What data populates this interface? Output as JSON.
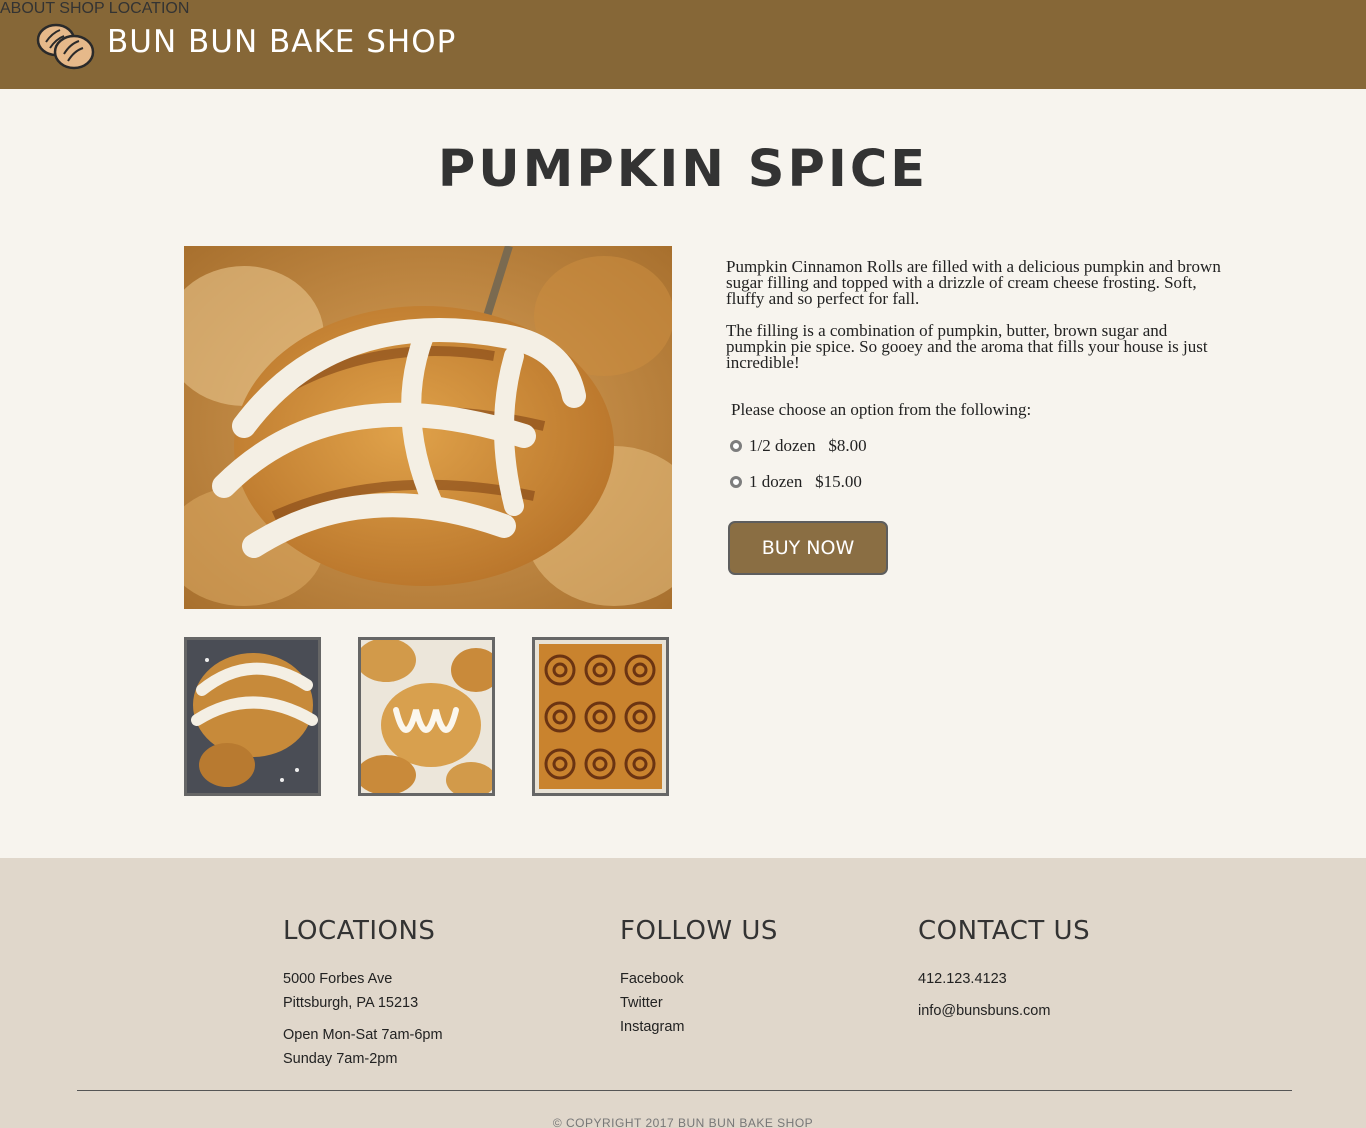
{
  "header": {
    "brand": "BUN BUN BAKE SHOP",
    "nav": {
      "about": "ABOUT",
      "shop": "SHOP",
      "location": "LOCATION"
    }
  },
  "product": {
    "title": "PUMPKIN SPICE",
    "description_1": "Pumpkin Cinnamon Rolls are filled with a delicious pumpkin and brown sugar filling and topped with a drizzle of cream cheese frosting. Soft, fluffy and so perfect for fall.",
    "description_2": "The filling is a combination of pumpkin, butter, brown sugar and pumpkin pie spice. So gooey and the aroma that fills your house is just incredible!",
    "prompt": "Please choose an option from the following:",
    "options": [
      {
        "label": "1/2 dozen   $8.00"
      },
      {
        "label": "1 dozen   $15.00"
      }
    ],
    "buy_label": "BUY NOW"
  },
  "footer": {
    "locations": {
      "heading": "LOCATIONS",
      "address_1": "5000 Forbes Ave",
      "address_2": "Pittsburgh, PA 15213",
      "hours_1": "Open Mon-Sat 7am-6pm",
      "hours_2": "Sunday 7am-2pm"
    },
    "follow": {
      "heading": "FOLLOW US",
      "links": [
        "Facebook",
        "Twitter",
        "Instagram"
      ]
    },
    "contact": {
      "heading": "CONTACT US",
      "phone": "412.123.4123",
      "email": "info@bunsbuns.com"
    },
    "copyright": "© COPYRIGHT 2017 BUN BUN BAKE SHOP"
  },
  "colors": {
    "header_bg": "#866737",
    "page_bg": "#f7f4ee",
    "footer_bg": "#e0d7cb",
    "button_bg": "#8a6e43"
  }
}
